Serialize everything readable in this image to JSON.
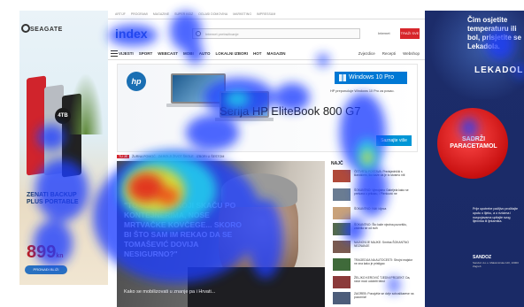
{
  "left_ad": {
    "brand": "SEAGATE",
    "capacity_badge": "4TB",
    "headline": "ZENATI BACKUP PLUS PORTABLE",
    "price": "899",
    "price_unit": "kn",
    "cta": "PRONAĐI BLIŽI"
  },
  "site": {
    "logo": "index",
    "topnav": [
      "ARTIJF",
      "PROGRAMI",
      "MAGAZINE",
      "SUPER KIDZ",
      "OGLASI DOMOVINA",
      "MARKETING",
      "IMPRESSUM"
    ],
    "search_placeholder": "Internet pretraživanje",
    "search_side_label": "Internet",
    "search_button": "TRAŽI SVE",
    "mainnav": [
      "VIJESTI",
      "SPORT",
      "WEBCAST",
      "MOBI",
      "AUTO",
      "LOKALNI IZBORI",
      "HOT",
      "MAGAZIN"
    ],
    "mainnav_right": [
      "Zvjezdice",
      "Recepti",
      "Webshop"
    ]
  },
  "hp_banner": {
    "logo": "hp",
    "windows_label": "Windows 10 Pro",
    "windows_tagline": "HP preporučuje Windows 10 Pro za posao.",
    "title": "Serija HP EliteBook 800 G7",
    "cta": "Saznajte više"
  },
  "headline_strip": {
    "hot": "TU JE",
    "items": [
      "ŽURNA POMOĆ",
      "ZA BOLJI ŽIVOT ŠKOLE",
      "IZBORI U ŠESTOM"
    ]
  },
  "story": {
    "quote": "\"TO SU LJUDI KOJI SKAČU PO KONTEJNERIMA, NOSE MRTVAČKE KOVČEGE... SKORO BI ŠTO SAM IM REKAO DA SE TOMAŠEVIĆ DOVIJA NESIGURNO?\"",
    "caption": "Kako se mobilizovati u znanje pa i Hrvati..."
  },
  "right_column": {
    "label": "NAJČ",
    "items": [
      "ČETVRTA POSTAVA: Predsjednički s Bandićem, tko kaže da je to stvarno niti",
      "ŠOKANTNO: Vjerojatno Gabrijela kako se pretvara u prikazu, i Plenković ne",
      "ŠOKANTNO: Niži i djeca",
      "ŠOKANTNO: Što kaže njezina pozorištu, zaštitila se od svih",
      "NAJNOVIJE MAJKE: Smrtna ŠOKANTNO NEZNANJE",
      "TRAGEDIJA NA AUTOCESTI: Strojni majstor ne zna kako je pristigao",
      "ŽELJKO KEROVIĆ TJEDNI PROJEKT: Da, neće moći odobriti tekst",
      "ZAGREB: Ponajviše se dvije soboslikareve na pozornici!"
    ]
  },
  "right_ad": {
    "headline": "Čim osjetite temperaturu ili bol, prisjetite se Lekadola.",
    "brand": "LEKADOL",
    "pill_text": "SADRŽI PARACETAMOL",
    "warning": "Prije upotrebe pažljivo pročitajte uputu o lijeku, a o rizicima i nuspojavama upitajte svog liječnika ili ljekarnika.",
    "company": "SANDOZ",
    "company_address": "Sandoz d.o.o. Maksimirska 120, 10000 Zagreb"
  },
  "colors": {
    "hp_blue": "#1a6fb3",
    "windows_blue": "#0078d4",
    "brand_red": "#d7262b",
    "lekadol_navy": "#1c2c6a"
  }
}
